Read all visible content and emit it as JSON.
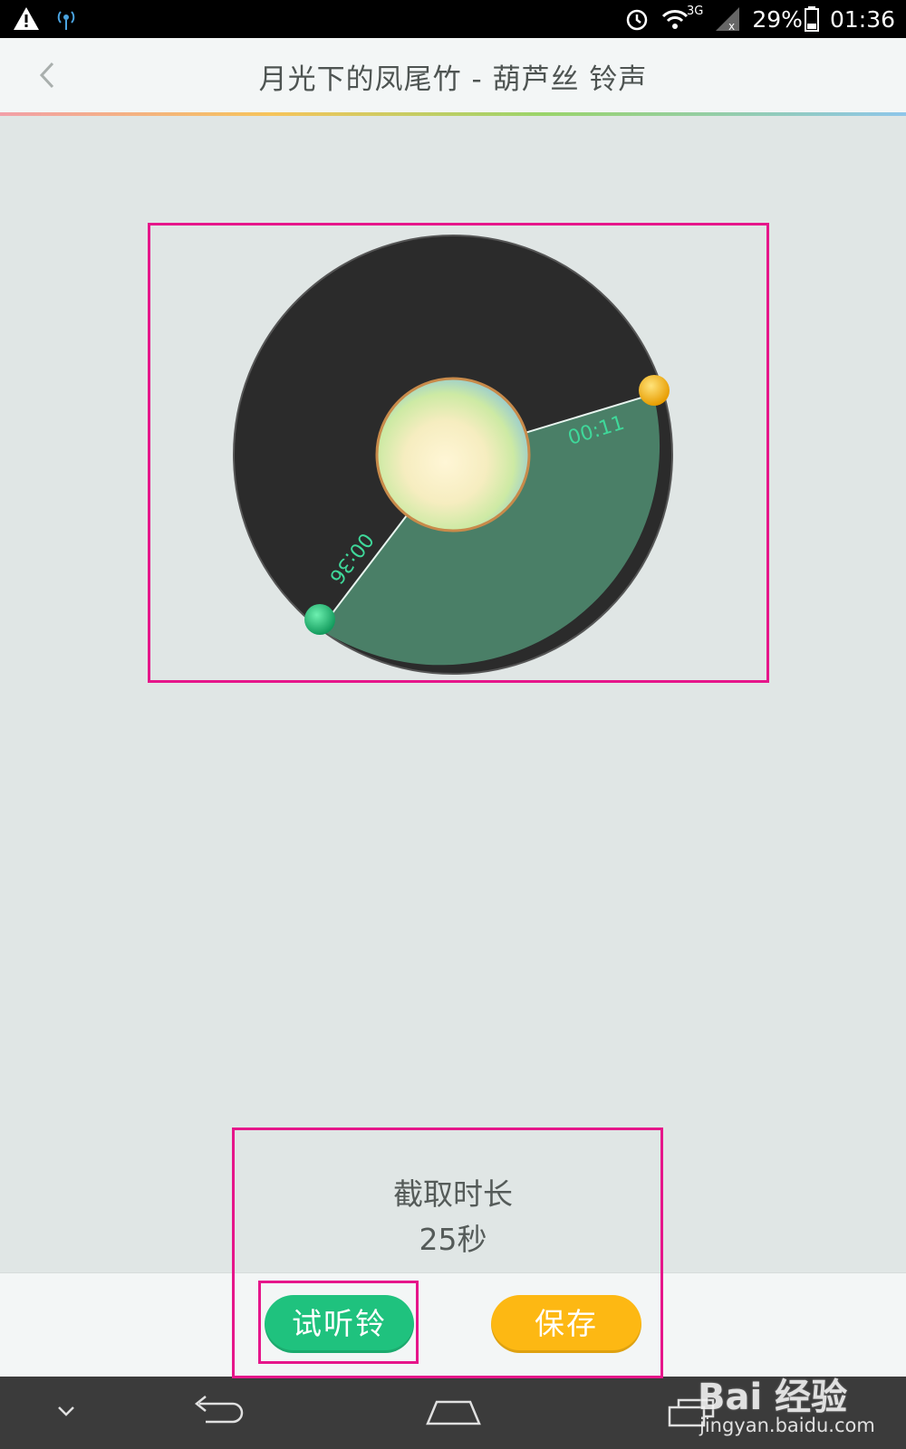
{
  "status_bar": {
    "battery": "29%",
    "time": "01:36",
    "network": "3G",
    "icons": [
      "warning-icon",
      "hotspot-icon",
      "alarm-icon",
      "wifi-icon",
      "signal-icon",
      "battery-icon"
    ]
  },
  "header": {
    "back_icon": "chevron-left-icon",
    "title": "月光下的凤尾竹 - 葫芦丝 铃声"
  },
  "disc": {
    "start_time": "00:11",
    "end_time": "00:36",
    "colors": {
      "disc": "#2b2b2b",
      "selection": "#4a7f67",
      "start_handle": "#fdb813",
      "end_handle": "#1fc27e",
      "time_text": "#3fd89a"
    }
  },
  "duration": {
    "label": "截取时长",
    "value": "25秒"
  },
  "actions": {
    "preview_label": "试听铃",
    "save_label": "保存"
  },
  "nav_bar": {
    "icons": [
      "chevron-down-icon",
      "back-arrow-icon",
      "home-icon",
      "recent-apps-icon"
    ]
  },
  "watermark": {
    "logo": "Bai 经验",
    "url": "jingyan.baidu.com"
  },
  "colors": {
    "highlight": "#e6168a",
    "background": "#e0e6e5"
  }
}
